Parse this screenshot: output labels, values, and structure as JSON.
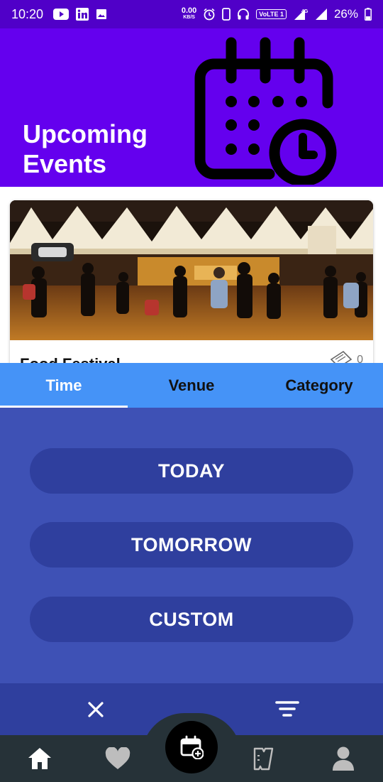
{
  "status_bar": {
    "time": "10:20",
    "netspeed_value": "0.00",
    "netspeed_unit": "KB/S",
    "volte": "VoLTE 1",
    "network": "4G",
    "battery": "26%"
  },
  "header": {
    "title": "Upcoming Events",
    "icon": "calendar-clock-icon",
    "bg_color": "#6400ee"
  },
  "event_card": {
    "title": "Food Festival",
    "ticket_count": "0"
  },
  "filter": {
    "tabs": [
      {
        "label": "Time",
        "active": true
      },
      {
        "label": "Venue",
        "active": false
      },
      {
        "label": "Category",
        "active": false
      }
    ],
    "options": [
      "TODAY",
      "TOMORROW",
      "CUSTOM"
    ],
    "colors": {
      "tab_bar": "#4593f7",
      "sheet": "#3e51b5",
      "button": "#2f3f9e"
    }
  },
  "actions": {
    "close_icon": "close-icon",
    "filter_icon": "filter-lines-icon"
  },
  "bottom_nav": {
    "items": [
      "home-icon",
      "heart-icon",
      "add-event-icon",
      "tickets-icon",
      "profile-icon"
    ],
    "active": "home-icon"
  }
}
